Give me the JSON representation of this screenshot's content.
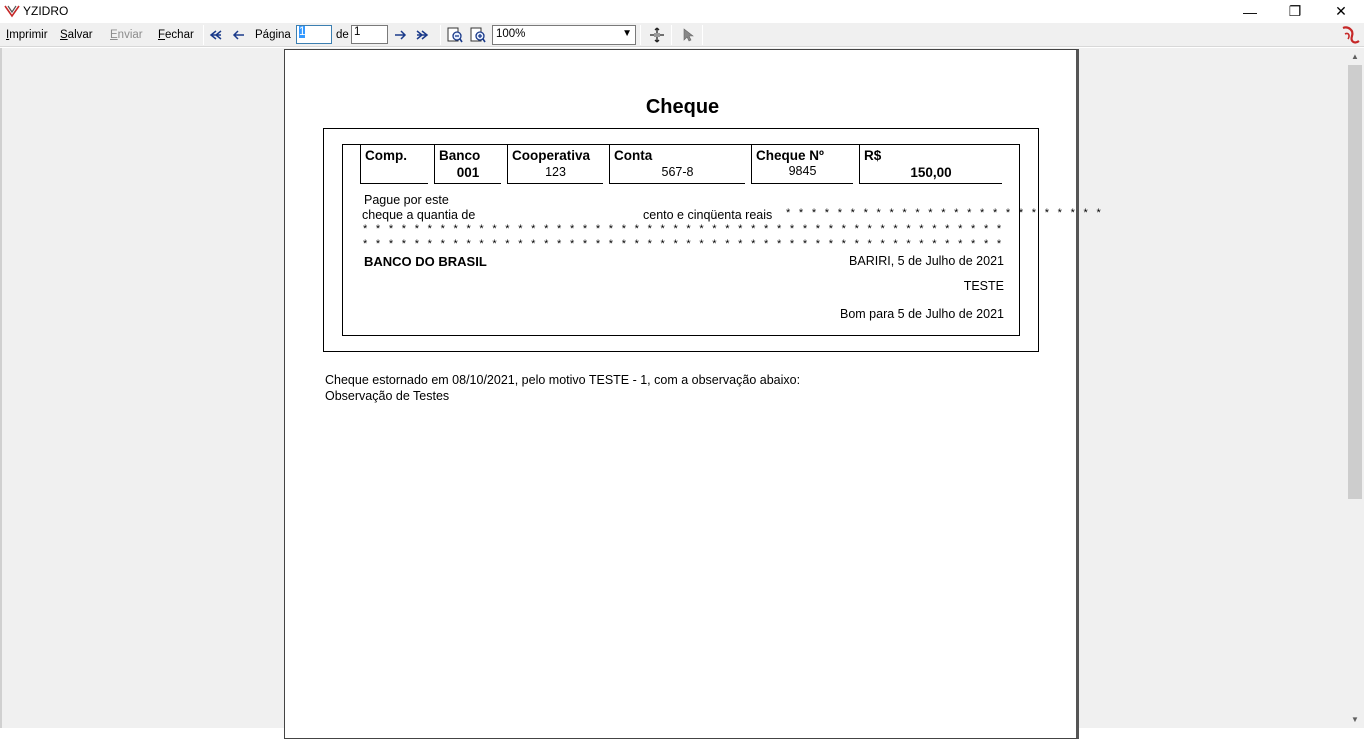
{
  "window": {
    "title": "YZIDRO",
    "minimize": "—",
    "maximize": "❐",
    "close": "✕"
  },
  "toolbar": {
    "print": {
      "acc": "I",
      "rest": "mprimir"
    },
    "save": {
      "acc": "S",
      "rest": "alvar"
    },
    "send": {
      "acc": "E",
      "rest": "nviar"
    },
    "close": {
      "acc": "F",
      "rest": "echar"
    },
    "page_label": "Página",
    "page_current": "1",
    "of_label": "de",
    "page_total": "1",
    "zoom": "100%"
  },
  "cheque": {
    "title": "Cheque",
    "fields": {
      "comp_label": "Comp.",
      "comp_value": "",
      "banco_label": "Banco",
      "banco_value": "001",
      "cooperativa_label": "Cooperativa",
      "cooperativa_value": "123",
      "conta_label": "Conta",
      "conta_value": "567-8",
      "cheque_label": "Cheque Nº",
      "cheque_value": "9845",
      "valor_label": "R$",
      "valor_value": "150,00"
    },
    "pague_line1": "Pague por este",
    "pague_line2": "cheque a quantia de",
    "amount_words": "cento e cinqüenta  reais",
    "stars_tail": "* * * * * * * * * * * * * * * * * * * * * * * * *",
    "stars_line": "* * * * * * * * * * * * * * * * * * * * * * * * * * * * * * * * * * * * * * * * * * * * * * * * * * * * * * * * * * * * * * * * * * * * * * * * * * * * * * * * * * * * * *",
    "bank_name": "BANCO DO BRASIL",
    "place_date": "BARIRI, 5 de Julho de 2021",
    "payee": "TESTE",
    "good_for": "Bom para 5 de Julho de 2021"
  },
  "note": {
    "line1": "Cheque estornado em 08/10/2021, pelo motivo TESTE - 1, com a observação abaixo:",
    "line2": "Observação de Testes"
  },
  "icons": {
    "first": "first-page-icon",
    "prev": "previous-page-icon",
    "next": "next-page-icon",
    "last": "last-page-icon",
    "zoom_out": "zoom-out-icon",
    "zoom_in": "zoom-in-icon",
    "pan": "pan-icon",
    "pointer": "pointer-icon"
  }
}
